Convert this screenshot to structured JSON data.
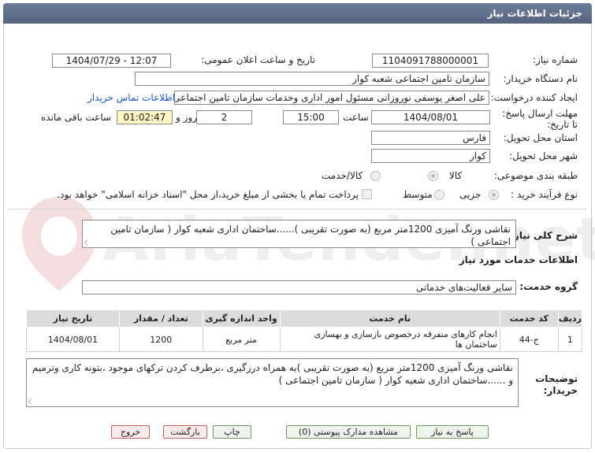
{
  "header": {
    "title": "جزئیات اطلاعات نیاز"
  },
  "form": {
    "need_number_label": "شماره نیاز:",
    "need_number": "1104091788000001",
    "announce_label": "تاریخ و ساعت اعلان عمومی:",
    "announce_value": "1404/07/29 - 12:07",
    "buyer_org_label": "نام دستگاه خریدار:",
    "buyer_org": "سازمان تامین اجتماعی شعبه کوار",
    "creator_label": "ایجاد کننده درخواست:",
    "creator": "علی اصغر  یوسفی نوروزانی  مسئول امور اداری وخدمات  سازمان تامین اجتماعی شعبه کوار",
    "contact_link": "اطلاعات تماس خریدار",
    "deadline_label": "مهلت ارسال پاسخ: تا تاریخ:",
    "deadline_date": "1404/08/01",
    "time_label": "ساعت",
    "deadline_time": "15:00",
    "days_value": "2",
    "days_label": "روز و",
    "remaining_time": "01:02:47",
    "remaining_label": "ساعت باقی مانده",
    "province_label": "استان محل تحویل:",
    "province": "فارس",
    "city_label": "شهر محل تحویل:",
    "city": "کوار",
    "category_label": "طبقه بندی موضوعی:",
    "category_options": [
      "کالا",
      "کالا/خدمت"
    ],
    "purchase_type_label": "نوع فرآیند خرید :",
    "purchase_options": [
      "جزیی",
      "متوسط"
    ],
    "payment_note": "پرداخت تمام یا بخشی از مبلغ خرید،از محل \"اسناد خزانه اسلامی\" خواهد بود."
  },
  "summary": {
    "label": "شرح کلی نیاز:",
    "text": "نقاشی ورنگ آمیزی 1200متر مربع (به صورت تقریبی )......ساختمان اداری شعبه کوار ( سازمان تامین اجتماعی )"
  },
  "services": {
    "section_title": "اطلاعات خدمات مورد نیاز",
    "group_label": "گروه خدمت:",
    "group_value": "سایر فعالیت‌های خدماتی",
    "table": {
      "headers": [
        "ردیف",
        "کد خدمت",
        "نام خدمت",
        "واحد اندازه گیری",
        "تعداد / مقدار",
        "تاریخ نیاز"
      ],
      "rows": [
        [
          "1",
          "ج-44",
          "انجام کارهای متفرقه درخصوص بازسازی و بهسازی ساختمان ها",
          "متر مربع",
          "1200",
          "1404/08/01"
        ]
      ]
    }
  },
  "buyer_notes": {
    "label": "توضیحات خریدار:",
    "text": "نقاشی ورنگ آمیزی 1200متر مربع (به صورت تقریبی )به همراه درزگیری ،برطرف کردن ترکهای موجود ،بتونه کاری وترمیم و ......ساختمان اداری شعبه کوار ( سازمان تامین اجتماعی )"
  },
  "buttons": {
    "respond": "پاسخ به نیاز",
    "attachments": "مشاهده مدارک پیوستی (0)",
    "print": "چاپ",
    "back": "بازگشت",
    "exit": "خروج"
  },
  "watermark": {
    "text": "AriaTender.net"
  }
}
